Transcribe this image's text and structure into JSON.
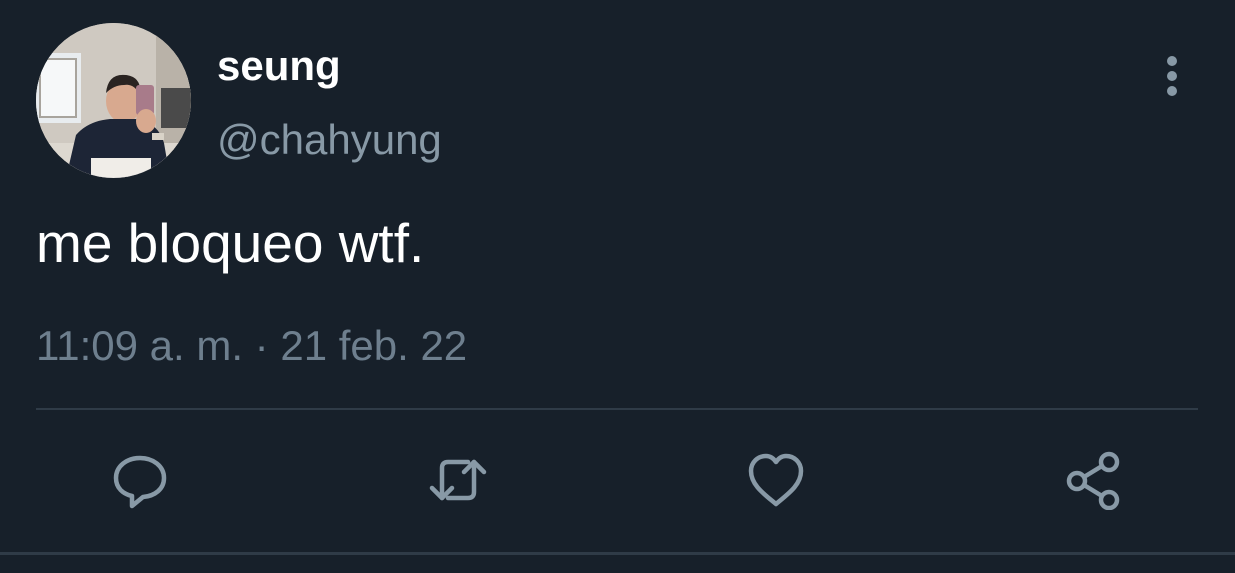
{
  "tweet": {
    "display_name": "seung",
    "handle": "@chahyung",
    "text": "me bloqueo wtf.",
    "timestamp": "11:09 a. m. · 21 feb. 22"
  },
  "icons": {
    "more": "more-vertical-icon",
    "reply": "reply-icon",
    "retweet": "retweet-icon",
    "like": "heart-icon",
    "share": "share-icon"
  },
  "colors": {
    "background": "#17202a",
    "primary_text": "#ffffff",
    "secondary_text": "#8899a6",
    "divider": "#2f3b47"
  }
}
